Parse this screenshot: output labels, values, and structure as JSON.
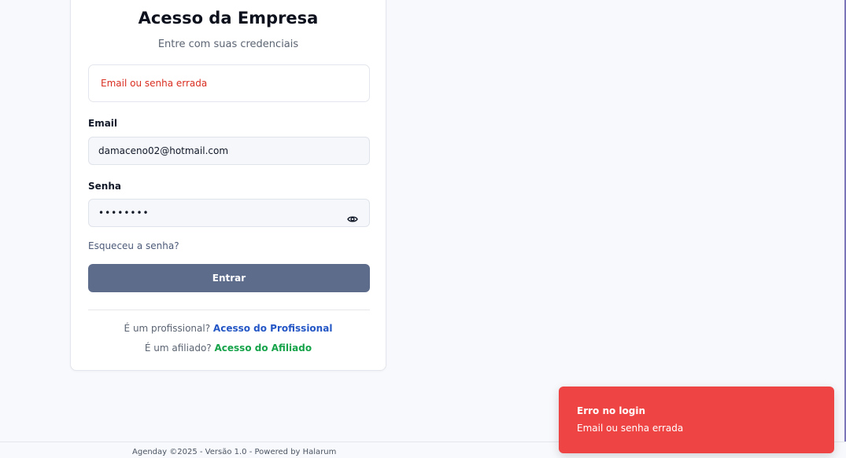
{
  "card": {
    "title": "Acesso da Empresa",
    "subtitle": "Entre com suas credenciais",
    "error_message": "Email ou senha errada"
  },
  "form": {
    "email_label": "Email",
    "email_value": "damaceno02@hotmail.com",
    "password_label": "Senha",
    "password_value": "••••••••",
    "password_toggle_icon": "eye-icon",
    "forgot_link": "Esqueceu a senha?",
    "submit_label": "Entrar"
  },
  "alt_access": {
    "professional_prompt": "É um profissional?",
    "professional_link": "Acesso do Profissional",
    "affiliate_prompt": "É um afiliado?",
    "affiliate_link": "Acesso do Afiliado"
  },
  "footer": {
    "text": "Agenday ©2025 - Versão 1.0 - Powered by Halarum"
  },
  "toast": {
    "title": "Erro no login",
    "message": "Email ou senha errada"
  },
  "colors": {
    "primary_button": "#5e6c8c",
    "error_text": "#d92d20",
    "toast_background": "#ef4444",
    "link_professional": "#2457c5",
    "link_affiliate": "#16a34a"
  }
}
